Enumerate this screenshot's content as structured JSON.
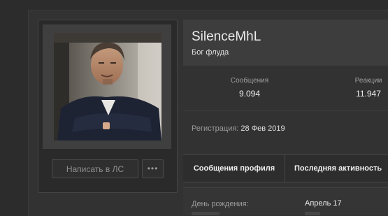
{
  "profile": {
    "username": "SilenceMhL",
    "user_title": "Бог флуда",
    "avatar_icon": "user-avatar-photo"
  },
  "actions": {
    "message_label": "Написать в ЛС",
    "more_label": "•••"
  },
  "stats": [
    {
      "label": "Сообщения",
      "value": "9.094"
    },
    {
      "label": "Реакции",
      "value": "11.947"
    }
  ],
  "registration": {
    "label": "Регистрация:",
    "date": "28 Фев 2019"
  },
  "tabs": [
    {
      "label": "Сообщения профиля"
    },
    {
      "label": "Последняя активность"
    }
  ],
  "details": [
    {
      "label": "День рождения:",
      "value": "Апрель 17"
    }
  ],
  "colors": {
    "background": "#2c2c2c",
    "panel": "#323232",
    "header_block": "#3d3d3d",
    "text_primary": "#ececec",
    "text_muted": "#9c9c9c"
  }
}
